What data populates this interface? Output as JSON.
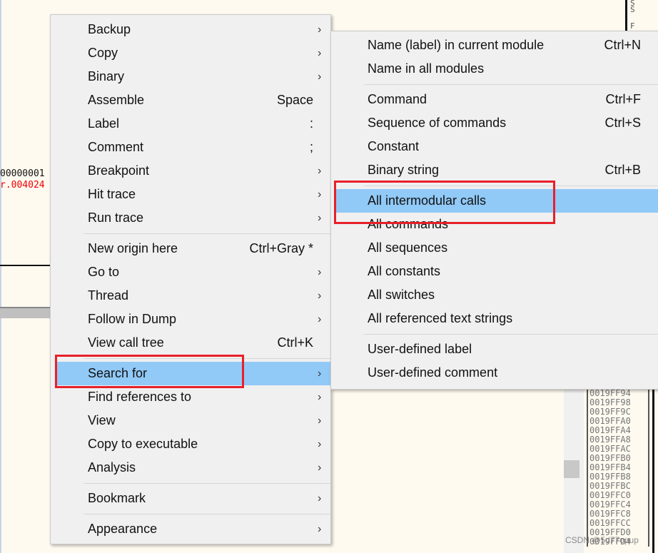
{
  "background": {
    "hex_line1": "00000001",
    "hex_line2": "r.004024",
    "right_top": [
      "S",
      "S",
      "F"
    ],
    "stack_addresses": [
      "0019FF94",
      "0019FF98",
      "0019FF9C",
      "0019FFA0",
      "0019FFA4",
      "0019FFA8",
      "0019FFAC",
      "0019FFB0",
      "0019FFB4",
      "0019FFB8",
      "0019FFBC",
      "0019FFC0",
      "0019FFC4",
      "0019FFC8",
      "0019FFCC",
      "0019FFD0",
      "0019FFD4"
    ]
  },
  "context_menu": {
    "groups": [
      [
        {
          "label": "Backup",
          "arrow": true
        },
        {
          "label": "Copy",
          "arrow": true
        },
        {
          "label": "Binary",
          "arrow": true
        },
        {
          "label": "Assemble",
          "shortcut": "Space"
        },
        {
          "label": "Label",
          "shortcut": ":"
        },
        {
          "label": "Comment",
          "shortcut": ";"
        },
        {
          "label": "Breakpoint",
          "arrow": true
        },
        {
          "label": "Hit trace",
          "arrow": true
        },
        {
          "label": "Run trace",
          "arrow": true
        }
      ],
      [
        {
          "label": "New origin here",
          "shortcut": "Ctrl+Gray *"
        },
        {
          "label": "Go to",
          "arrow": true
        },
        {
          "label": "Thread",
          "arrow": true
        },
        {
          "label": "Follow in Dump",
          "arrow": true
        },
        {
          "label": "View call tree",
          "shortcut": "Ctrl+K"
        }
      ],
      [
        {
          "label": "Search for",
          "arrow": true,
          "highlighted": true
        },
        {
          "label": "Find references to",
          "arrow": true
        },
        {
          "label": "View",
          "arrow": true
        },
        {
          "label": "Copy to executable",
          "arrow": true
        },
        {
          "label": "Analysis",
          "arrow": true
        }
      ],
      [
        {
          "label": "Bookmark",
          "arrow": true
        }
      ],
      [
        {
          "label": "Appearance",
          "arrow": true
        }
      ]
    ]
  },
  "submenu": {
    "groups": [
      [
        {
          "label": "Name (label) in current module",
          "shortcut": "Ctrl+N"
        },
        {
          "label": "Name in all modules"
        }
      ],
      [
        {
          "label": "Command",
          "shortcut": "Ctrl+F"
        },
        {
          "label": "Sequence of commands",
          "shortcut": "Ctrl+S"
        },
        {
          "label": "Constant"
        },
        {
          "label": "Binary string",
          "shortcut": "Ctrl+B"
        }
      ],
      [
        {
          "label": "All intermodular calls",
          "highlighted": true
        },
        {
          "label": "All commands"
        },
        {
          "label": "All sequences"
        },
        {
          "label": "All constants"
        },
        {
          "label": "All switches"
        },
        {
          "label": "All referenced text strings"
        }
      ],
      [
        {
          "label": "User-defined label"
        },
        {
          "label": "User-defined comment"
        }
      ]
    ]
  },
  "colors": {
    "highlight": "#91c9f7",
    "annotation": "#e8202a",
    "background": "#fffaf0"
  },
  "watermark": "CSDN @5d77opup"
}
